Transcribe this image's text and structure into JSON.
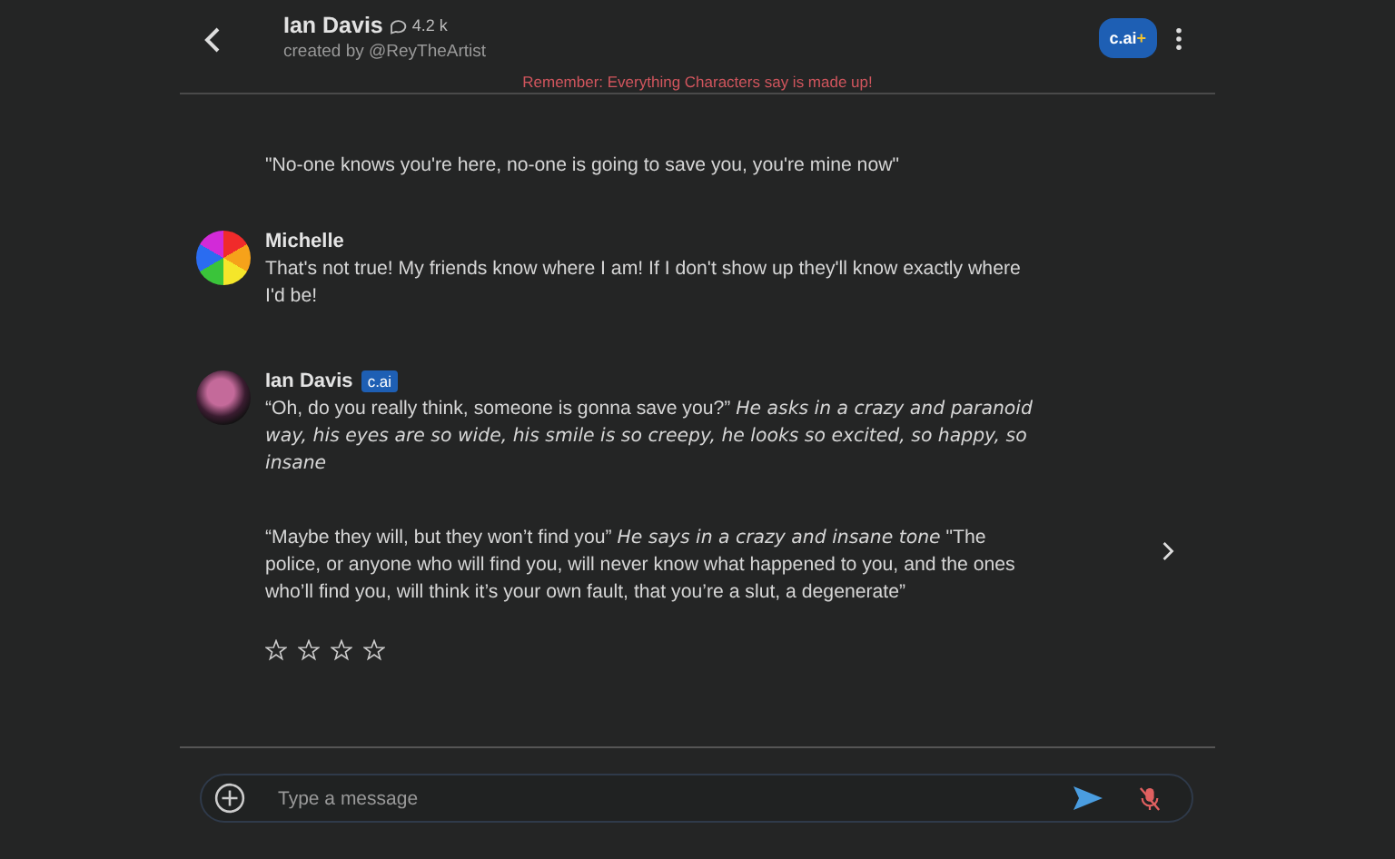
{
  "header": {
    "name": "Ian Davis",
    "chats": "4.2 k",
    "creator": "created by @ReyTheArtist",
    "plan_badge": "c.ai",
    "plan_plus": "+",
    "notice": "Remember: Everything Characters say is made up!"
  },
  "messages": [
    {
      "kind": "continuation",
      "paragraphs": [
        "\"No-one knows you're here, no-one is going to save you, you're mine now\""
      ]
    },
    {
      "kind": "user",
      "author": "Michelle",
      "paragraphs": [
        "That's not true! My friends know where I am! If I don't show up they'll know exactly where I'd be!"
      ]
    },
    {
      "kind": "character",
      "author": "Ian Davis",
      "badge": "c.ai",
      "paragraphs": [
        "“Oh, do you really think, someone is gonna save you?” *He asks in a crazy and paranoid way, his eyes are so wide, his smile is so creepy, he looks so excited, so happy, so insane*",
        "“Maybe they will, but they won’t find you” *He says in a crazy and insane tone* \"The police, or anyone who will find you, will never know what happened to you, and the ones who’ll find you, will think it’s your own fault, that you’re a slut, a degenerate”"
      ],
      "stars": 0,
      "has_next": true
    }
  ],
  "composer": {
    "placeholder": "Type a message"
  }
}
